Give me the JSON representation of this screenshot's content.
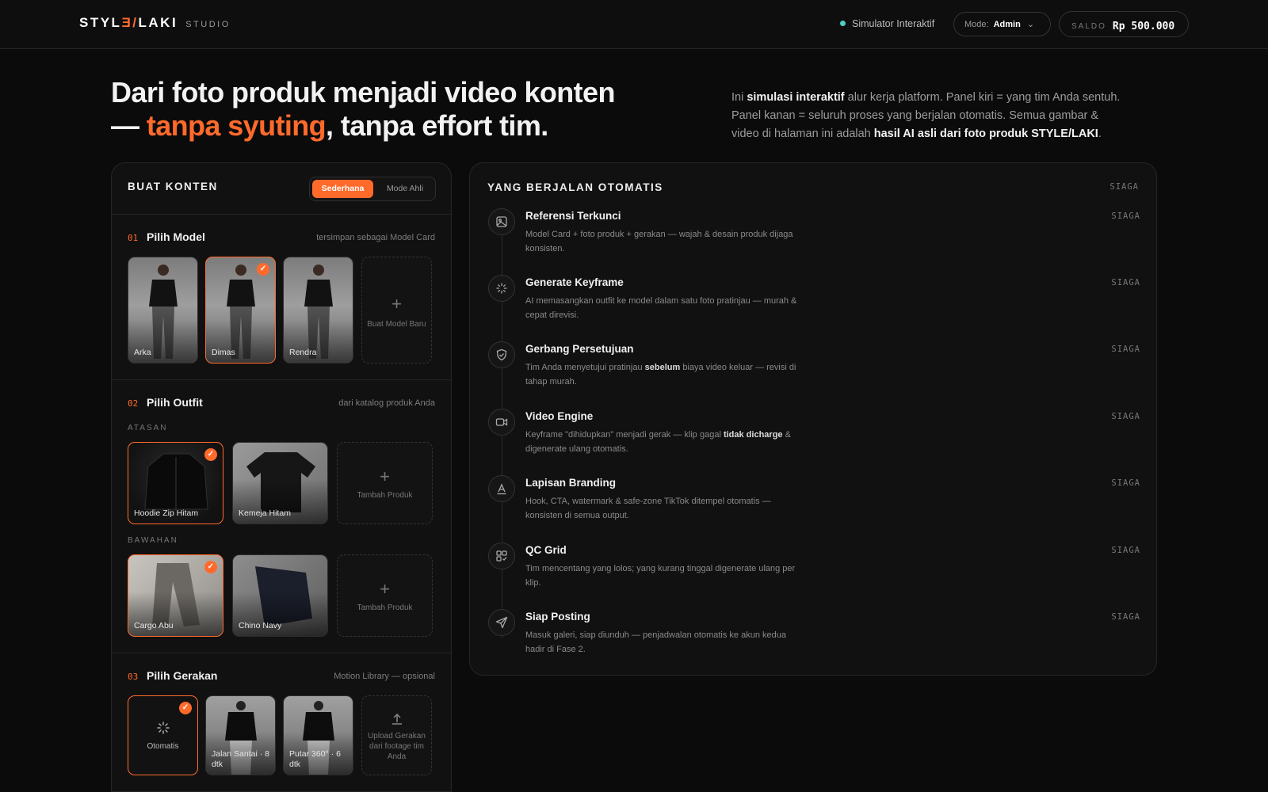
{
  "header": {
    "logo_pre": "STYL",
    "logo_accent": "Ǝ/",
    "logo_post": "LAKI",
    "logo_sub": "STUDIO",
    "simulator_label": "Simulator Interaktif",
    "mode_label": "Mode:",
    "mode_value": "Admin",
    "saldo_label": "SALDO",
    "saldo_value": "Rp 500.000"
  },
  "hero": {
    "title_line1": "Dari foto produk menjadi video konten",
    "title_dash": "— ",
    "title_accent": "tanpa syuting",
    "title_end": ", tanpa effort tim.",
    "intro_1": "Ini ",
    "intro_b1": "simulasi interaktif",
    "intro_2": " alur kerja platform. Panel kiri = yang tim Anda sentuh. Panel kanan = seluruh proses yang berjalan otomatis. Semua gambar & video di halaman ini adalah ",
    "intro_b2": "hasil AI asli dari foto produk STYLE/LAKI",
    "intro_3": "."
  },
  "left": {
    "title": "BUAT KONTEN",
    "toggle_simple": "Sederhana",
    "toggle_expert": "Mode Ahli",
    "sec1": {
      "num": "01",
      "title": "Pilih Model",
      "note": "tersimpan sebagai Model Card",
      "models": [
        "Arka",
        "Dimas",
        "Rendra"
      ],
      "add_label": "Buat Model Baru"
    },
    "sec2": {
      "num": "02",
      "title": "Pilih Outfit",
      "note": "dari katalog produk Anda",
      "tops_label": "ATASAN",
      "tops": [
        "Hoodie Zip Hitam",
        "Kemeja Hitam"
      ],
      "bottoms_label": "BAWAHAN",
      "bottoms": [
        "Cargo Abu",
        "Chino Navy"
      ],
      "add_label": "Tambah Produk"
    },
    "sec3": {
      "num": "03",
      "title": "Pilih Gerakan",
      "note": "Motion Library — opsional",
      "auto_label": "Otomatis",
      "moves": [
        "Jalan Santai · 8 dtk",
        "Putar 360° · 6 dtk"
      ],
      "upload_label": "Upload Gerakan dari footage tim Anda"
    }
  },
  "right": {
    "title": "YANG BERJALAN OTOMATIS",
    "status": "SIAGA",
    "steps": [
      {
        "icon": "image-icon",
        "title": "Referensi Terkunci",
        "d1": "Model Card + foto produk + gerakan — wajah & desain produk dijaga konsisten.",
        "db": "",
        "d2": "",
        "status": "SIAGA"
      },
      {
        "icon": "loader-icon",
        "title": "Generate Keyframe",
        "d1": "AI memasangkan outfit ke model dalam satu foto pratinjau — murah & cepat direvisi.",
        "db": "",
        "d2": "",
        "status": "SIAGA"
      },
      {
        "icon": "shield-check-icon",
        "title": "Gerbang Persetujuan",
        "d1": "Tim Anda menyetujui pratinjau ",
        "db": "sebelum",
        "d2": " biaya video keluar — revisi di tahap murah.",
        "status": "SIAGA"
      },
      {
        "icon": "video-icon",
        "title": "Video Engine",
        "d1": "Keyframe \"dihidupkan\" menjadi gerak — klip gagal ",
        "db": "tidak dicharge",
        "d2": " & digenerate ulang otomatis.",
        "status": "SIAGA"
      },
      {
        "icon": "type-icon",
        "title": "Lapisan Branding",
        "d1": "Hook, CTA, watermark & safe-zone TikTok ditempel otomatis — konsisten di semua output.",
        "db": "",
        "d2": "",
        "status": "SIAGA"
      },
      {
        "icon": "grid-icon",
        "title": "QC Grid",
        "d1": "Tim mencentang yang lolos; yang kurang tinggal digenerate ulang per klip.",
        "db": "",
        "d2": "",
        "status": "SIAGA"
      },
      {
        "icon": "send-icon",
        "title": "Siap Posting",
        "d1": "Masuk galeri, siap diunduh — penjadwalan otomatis ke akun kedua hadir di Fase 2.",
        "db": "",
        "d2": "",
        "status": "SIAGA"
      }
    ]
  },
  "colors": {
    "accent": "#ff6a2b",
    "status_dot": "#4fd1c5",
    "background": "#0b0b0b",
    "panel": "#111111"
  }
}
